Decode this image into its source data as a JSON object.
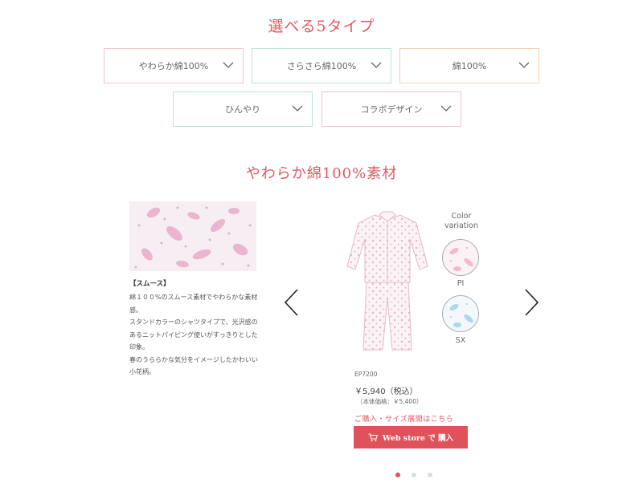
{
  "section_types": {
    "title": "選べる5タイプ"
  },
  "types": [
    {
      "label": "やわらか綿100%",
      "border": "#f2c4c8"
    },
    {
      "label": "さらさら綿100%",
      "border": "#b8e6e0"
    },
    {
      "label": "綿100%",
      "border": "#f6d2b6"
    },
    {
      "label": "ひんやり",
      "border": "#b8e6e0"
    },
    {
      "label": "コラボデザイン",
      "border": "#f2c4c8"
    }
  ],
  "section_material": {
    "title": "やわらか綿100%素材"
  },
  "product": {
    "desc_title": "【スムース】",
    "desc_lines": [
      "綿１００%のスムース素材でやわらかな素材",
      "感。",
      "スタンドカラーのシャツタイプで、光沢感の",
      "あるニットパイピング使いがすっきりとした",
      "印象。",
      "春のうららかな気分をイメージしたかわいい",
      "小花柄。"
    ],
    "color_heading": [
      "Color",
      "variation"
    ],
    "colors": [
      {
        "label": "PI",
        "tint": "#f3b9c8"
      },
      {
        "label": "SX",
        "tint": "#a9d8ea"
      }
    ],
    "sku": "EP7200",
    "price": "￥5,940（税込）",
    "base_price": "（本体価格：￥5,400）",
    "purchase_link": "ご購入・サイズ展開はこちら",
    "web_store_label": "Web store で 購入"
  },
  "carousel": {
    "dots": 3,
    "active": 0
  },
  "colors": {
    "accent": "#e0525b",
    "title": "#e05a64",
    "dot_inactive": "#dddddd"
  },
  "icons": [
    "chevron-down-icon",
    "arrow-left-icon",
    "arrow-right-icon",
    "cart-icon"
  ]
}
